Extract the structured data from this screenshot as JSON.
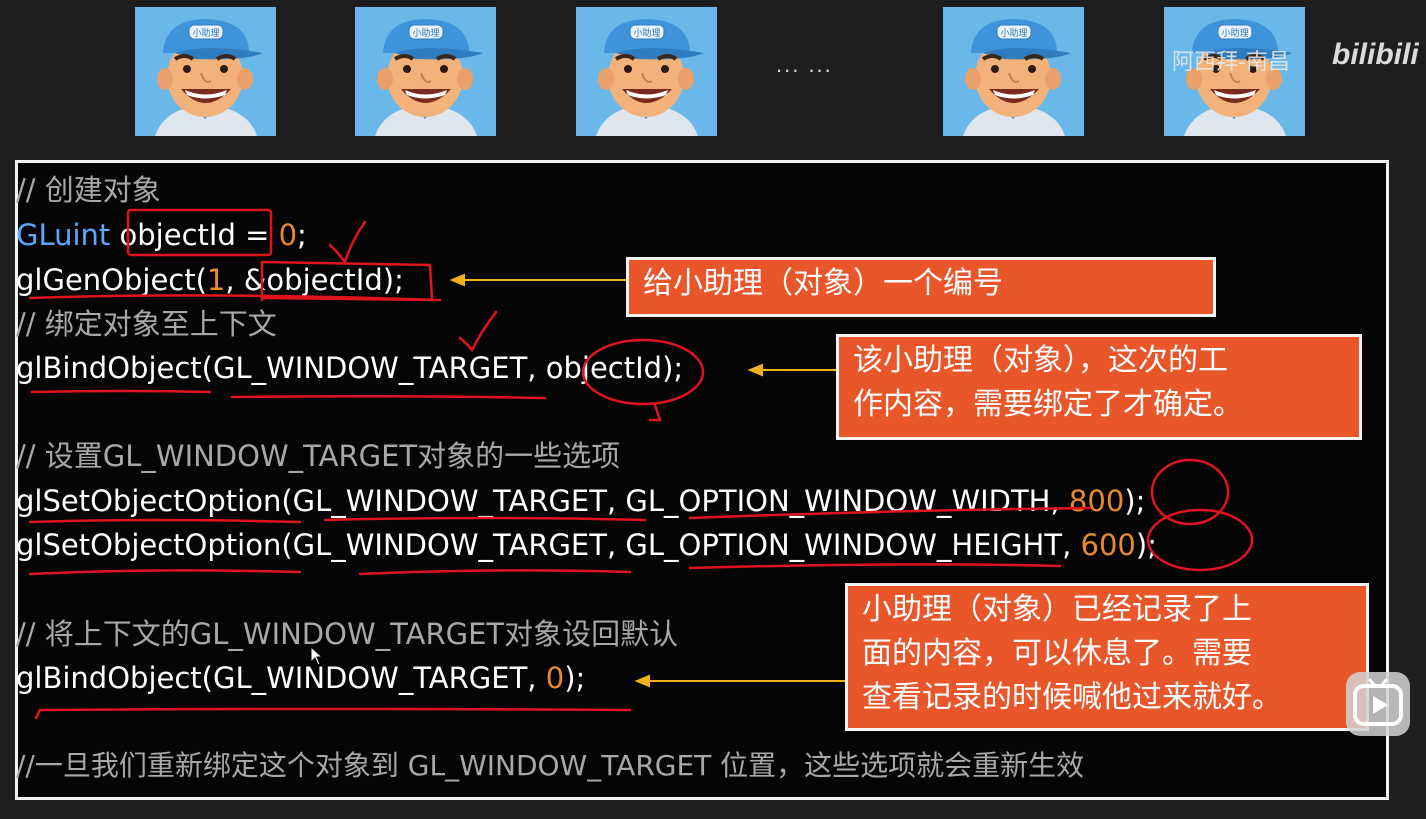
{
  "header": {
    "avatar_cap_text": "小助理",
    "ellipsis": "... ...",
    "watermark_text": "阿西拜-南昌",
    "watermark_logo": "bilibili"
  },
  "code_lines": [
    {
      "parts": [
        {
          "text": "// 创建对象",
          "cls": "comment"
        }
      ]
    },
    {
      "parts": [
        {
          "text": "GLuint",
          "cls": "type"
        },
        {
          "text": " objectId = ",
          "cls": ""
        },
        {
          "text": "0",
          "cls": "num"
        },
        {
          "text": ";",
          "cls": ""
        }
      ]
    },
    {
      "parts": [
        {
          "text": "glGenObject(",
          "cls": ""
        },
        {
          "text": "1",
          "cls": "num"
        },
        {
          "text": ", &objectId);",
          "cls": ""
        }
      ]
    },
    {
      "parts": [
        {
          "text": "// 绑定对象至上下文",
          "cls": "comment"
        }
      ]
    },
    {
      "parts": [
        {
          "text": "glBindObject(GL_WINDOW_TARGET, objectId);",
          "cls": ""
        }
      ]
    },
    {
      "parts": [
        {
          "text": "// 设置GL_WINDOW_TARGET对象的一些选项",
          "cls": "comment"
        }
      ]
    },
    {
      "parts": [
        {
          "text": "glSetObjectOption(GL_WINDOW_TARGET, GL_OPTION_WINDOW_WIDTH, ",
          "cls": ""
        },
        {
          "text": "800",
          "cls": "num"
        },
        {
          "text": ");",
          "cls": ""
        }
      ]
    },
    {
      "parts": [
        {
          "text": "glSetObjectOption(GL_WINDOW_TARGET, GL_OPTION_WINDOW_HEIGHT, ",
          "cls": ""
        },
        {
          "text": "600",
          "cls": "num"
        },
        {
          "text": ");",
          "cls": ""
        }
      ]
    },
    {
      "parts": [
        {
          "text": "// 将上下文的GL_WINDOW_TARGET对象设回默认",
          "cls": "comment"
        }
      ]
    },
    {
      "parts": [
        {
          "text": "glBindObject(GL_WINDOW_TARGET, ",
          "cls": ""
        },
        {
          "text": "0",
          "cls": "num"
        },
        {
          "text": ");",
          "cls": ""
        }
      ]
    },
    {
      "parts": [
        {
          "text": "//一旦我们重新绑定这个对象到 GL_WINDOW_TARGET 位置，这些选项就会重新生效",
          "cls": "comment"
        }
      ]
    }
  ],
  "callouts": [
    {
      "lines": [
        "给小助理（对象）一个编号"
      ]
    },
    {
      "lines": [
        "该小助理（对象），这次的工",
        "作内容，需要绑定了才确定。"
      ]
    },
    {
      "lines": [
        "小助理（对象）已经记录了上",
        "面的内容，可以休息了。需要",
        "查看记录的时候喊他过来就好。"
      ]
    }
  ],
  "colors": {
    "callout_bg": "#e8562a",
    "annotation_red": "#e0141e",
    "arrow_yellow": "#f0b020",
    "type_blue": "#5aa8ff",
    "number_orange": "#e8892b"
  },
  "icons": {
    "play": "play-icon",
    "cursor": "mouse-cursor-icon",
    "avatar": "assistant-avatar-icon"
  }
}
